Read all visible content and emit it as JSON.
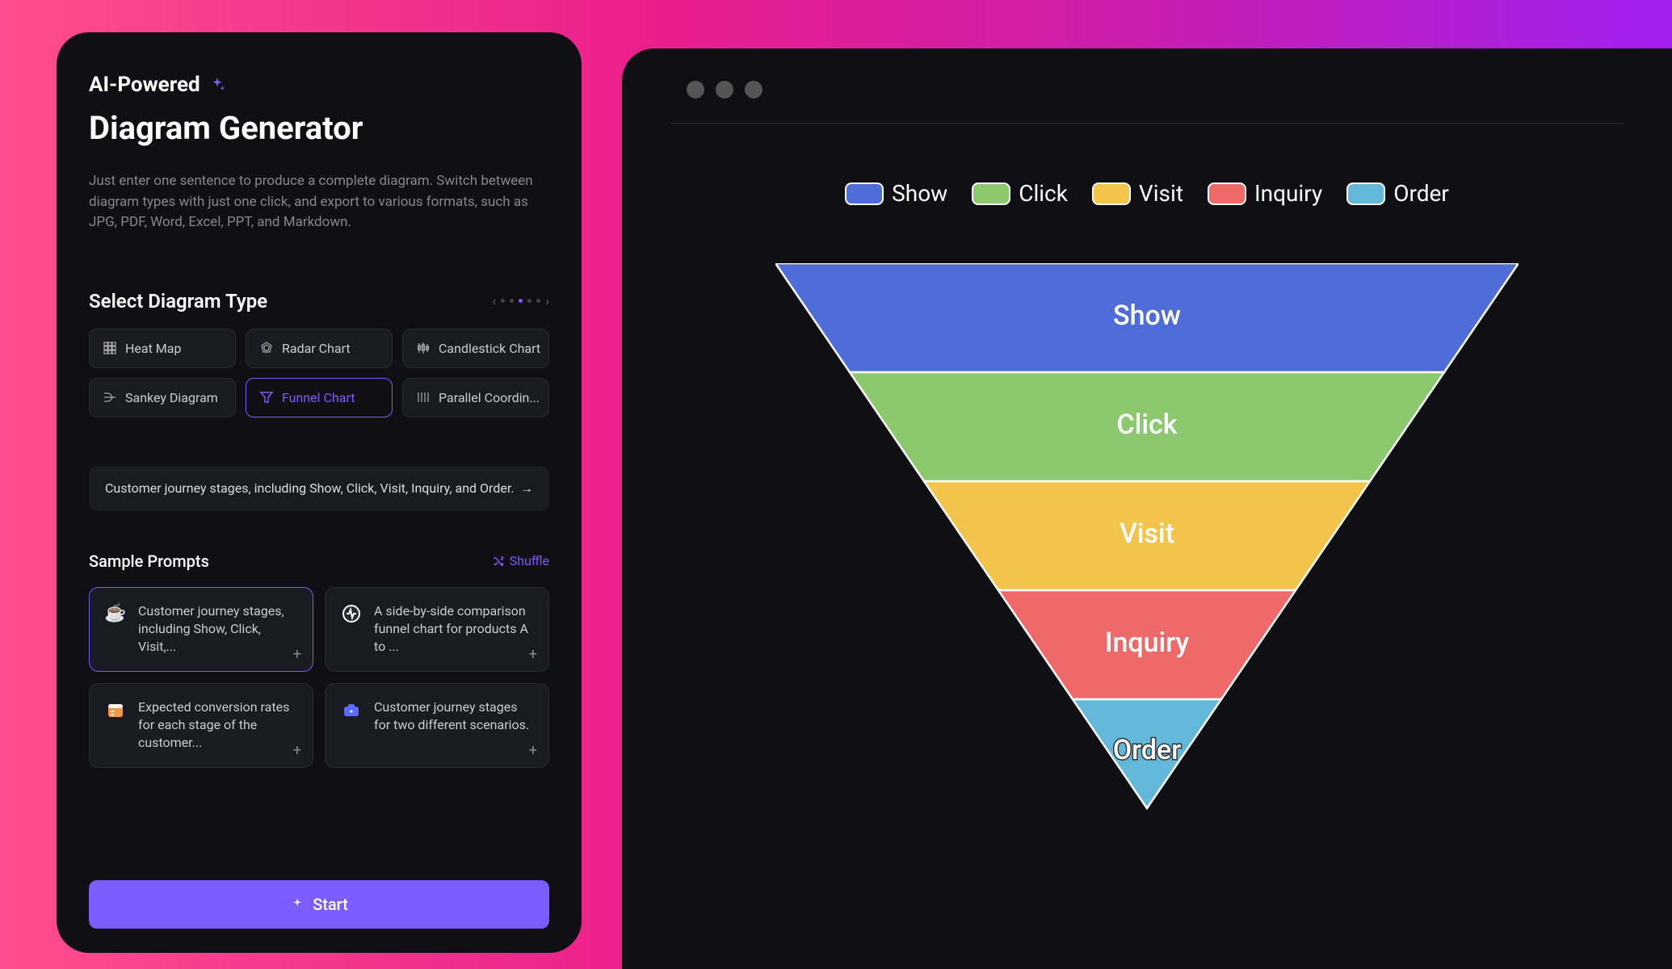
{
  "header": {
    "ai_label": "AI-Powered",
    "title": "Diagram Generator",
    "description": "Just enter one sentence to produce a complete diagram. Switch between diagram types with just one click, and export to various formats, such as JPG, PDF, Word, Excel, PPT, and Markdown."
  },
  "section": {
    "title": "Select Diagram Type"
  },
  "chart_types": [
    {
      "name": "Heat Map",
      "icon": "heatmap-icon"
    },
    {
      "name": "Radar Chart",
      "icon": "radar-icon"
    },
    {
      "name": "Candlestick Chart",
      "icon": "candlestick-icon"
    },
    {
      "name": "Sankey Diagram",
      "icon": "sankey-icon"
    },
    {
      "name": "Funnel Chart",
      "icon": "funnel-icon",
      "selected": true
    },
    {
      "name": "Parallel Coordin...",
      "icon": "parallel-icon"
    }
  ],
  "prompt": {
    "value": "Customer journey stages, including Show, Click, Visit, Inquiry, and Order."
  },
  "samples": {
    "title": "Sample Prompts",
    "shuffle_label": "Shuffle",
    "items": [
      {
        "icon": "☕",
        "text": "Customer journey stages, including Show, Click, Visit,...",
        "selected": true
      },
      {
        "icon": "pulse",
        "text": "A side-by-side comparison funnel chart for products A to ..."
      },
      {
        "icon": "calendar",
        "text": "Expected conversion rates for each stage of the customer..."
      },
      {
        "icon": "briefcase",
        "text": "Customer journey stages for two different scenarios."
      }
    ]
  },
  "start_label": "Start",
  "chart_data": {
    "type": "funnel",
    "title": "",
    "legend": [
      {
        "label": "Show",
        "color": "#4f6dd8"
      },
      {
        "label": "Click",
        "color": "#8cc86e"
      },
      {
        "label": "Visit",
        "color": "#f2c44b"
      },
      {
        "label": "Inquiry",
        "color": "#ee6a6a"
      },
      {
        "label": "Order",
        "color": "#63b8da"
      }
    ],
    "stages": [
      {
        "label": "Show",
        "value": 100,
        "color": "#4f6dd8"
      },
      {
        "label": "Click",
        "value": 80,
        "color": "#8cc86e"
      },
      {
        "label": "Visit",
        "value": 60,
        "color": "#f2c44b"
      },
      {
        "label": "Inquiry",
        "value": 40,
        "color": "#ee6a6a"
      },
      {
        "label": "Order",
        "value": 20,
        "color": "#63b8da"
      }
    ]
  }
}
